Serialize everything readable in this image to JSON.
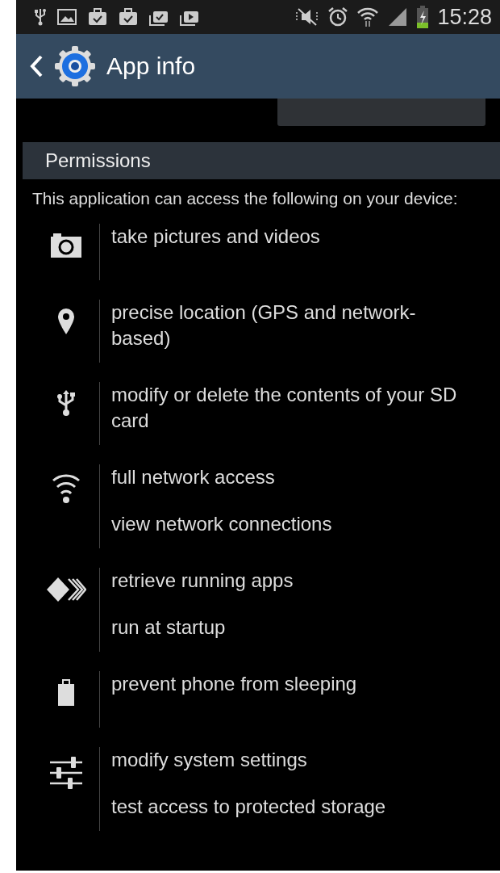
{
  "status_bar": {
    "time": "15:28"
  },
  "action_bar": {
    "title": "App info"
  },
  "section": {
    "title": "Permissions"
  },
  "intro": "This application can access the following on your device:",
  "permission_groups": [
    {
      "kind": "camera",
      "permissions": [
        "take pictures and videos"
      ]
    },
    {
      "kind": "location",
      "permissions": [
        "precise location (GPS and network-based)"
      ]
    },
    {
      "kind": "storage",
      "permissions": [
        "modify or delete the contents of your SD card"
      ]
    },
    {
      "kind": "network",
      "permissions": [
        "full network access",
        "view network connections"
      ]
    },
    {
      "kind": "apps",
      "permissions": [
        "retrieve running apps",
        "run at startup"
      ]
    },
    {
      "kind": "battery",
      "permissions": [
        "prevent phone from sleeping"
      ]
    },
    {
      "kind": "settings",
      "permissions": [
        "modify system settings",
        "test access to protected storage"
      ]
    }
  ]
}
